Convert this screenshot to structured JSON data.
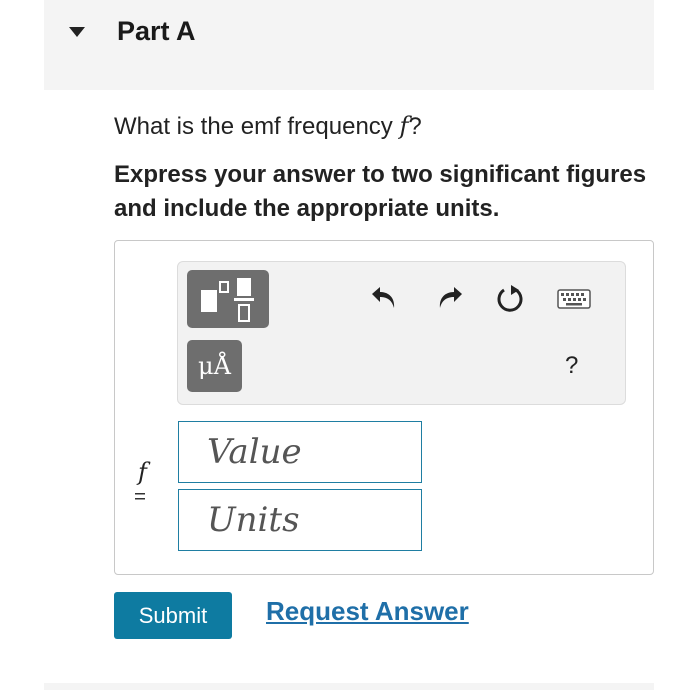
{
  "part": {
    "title": "Part A"
  },
  "question": {
    "prefix": "What is the emf frequency ",
    "variable": "f",
    "suffix": "?"
  },
  "instruction": "Express your answer to two significant figures and include the appropriate units.",
  "toolbar": {
    "template_icon": "fraction-template-icon",
    "units_label": "μÅ",
    "undo_icon": "undo-icon",
    "redo_icon": "redo-icon",
    "reset_icon": "reset-icon",
    "keyboard_icon": "keyboard-icon",
    "help_label": "?"
  },
  "answer": {
    "variable": "f",
    "equals": "=",
    "value_placeholder": "Value",
    "units_placeholder": "Units"
  },
  "actions": {
    "submit_label": "Submit",
    "request_label": "Request Answer"
  },
  "colors": {
    "accent": "#0e7ba1",
    "link": "#1f6fa8",
    "input_border": "#1f7ea2",
    "button_gray": "#6e6e6e"
  }
}
